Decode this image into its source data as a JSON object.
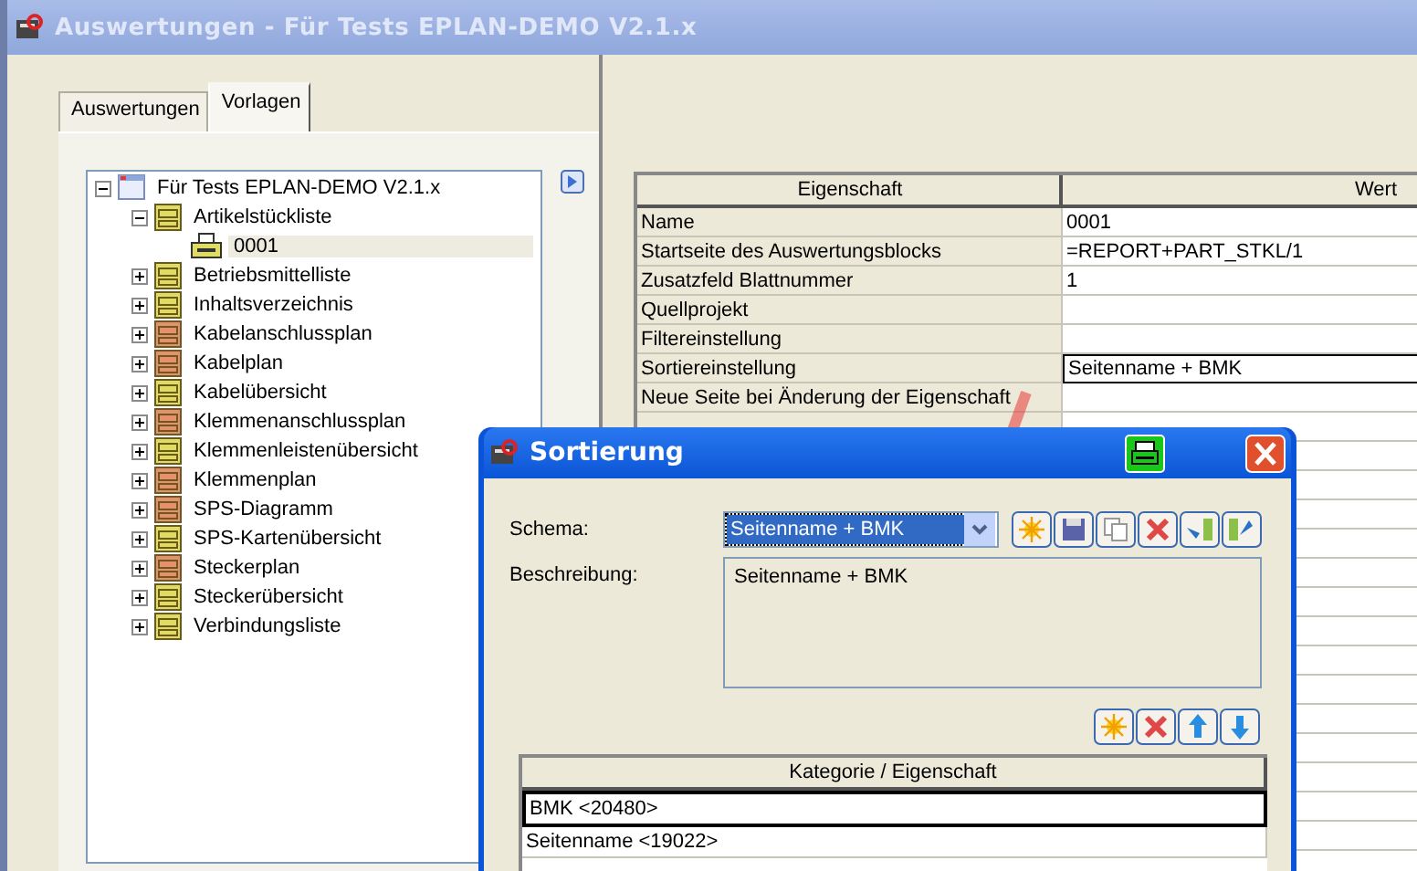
{
  "window": {
    "title": "Auswertungen - Für Tests EPLAN-DEMO V2.1.x"
  },
  "tabs": [
    {
      "label": "Auswertungen",
      "selected": false
    },
    {
      "label": "Vorlagen",
      "selected": true
    }
  ],
  "tree": {
    "label": "Für Tests EPLAN-DEMO V2.1.x",
    "kind": "project",
    "expanded": true,
    "selected": false,
    "children": [
      {
        "label": "Artikelstückliste",
        "kind": "report",
        "color": "#e0dc60",
        "expanded": true,
        "selected": false,
        "children": [
          {
            "label": "0001",
            "kind": "template",
            "selected": true
          }
        ]
      },
      {
        "label": "Betriebsmittelliste",
        "kind": "report",
        "color": "#e0dc60",
        "expanded": false,
        "selected": false
      },
      {
        "label": "Inhaltsverzeichnis",
        "kind": "report",
        "color": "#e0dc60",
        "expanded": false,
        "selected": false
      },
      {
        "label": "Kabelanschlussplan",
        "kind": "report",
        "color": "#e8906c",
        "expanded": false,
        "selected": false
      },
      {
        "label": "Kabelplan",
        "kind": "report",
        "color": "#e8906c",
        "expanded": false,
        "selected": false
      },
      {
        "label": "Kabelübersicht",
        "kind": "report",
        "color": "#e0dc60",
        "expanded": false,
        "selected": false
      },
      {
        "label": "Klemmenanschlussplan",
        "kind": "report",
        "color": "#e8906c",
        "expanded": false,
        "selected": false
      },
      {
        "label": "Klemmenleistenübersicht",
        "kind": "report",
        "color": "#e0dc60",
        "expanded": false,
        "selected": false
      },
      {
        "label": "Klemmenplan",
        "kind": "report",
        "color": "#e8906c",
        "expanded": false,
        "selected": false
      },
      {
        "label": "SPS-Diagramm",
        "kind": "report",
        "color": "#e8906c",
        "expanded": false,
        "selected": false
      },
      {
        "label": "SPS-Kartenübersicht",
        "kind": "report",
        "color": "#e0dc60",
        "expanded": false,
        "selected": false
      },
      {
        "label": "Steckerplan",
        "kind": "report",
        "color": "#e8906c",
        "expanded": false,
        "selected": false
      },
      {
        "label": "Steckerübersicht",
        "kind": "report",
        "color": "#e0dc60",
        "expanded": false,
        "selected": false
      },
      {
        "label": "Verbindungsliste",
        "kind": "report",
        "color": "#e0dc60",
        "expanded": false,
        "selected": false
      }
    ]
  },
  "properties": {
    "columns": [
      "Eigenschaft",
      "Wert"
    ],
    "rows": [
      {
        "name": "Name",
        "value": "0001",
        "selected": false
      },
      {
        "name": "Startseite des Auswertungsblocks",
        "value": "=REPORT+PART_STKL/1",
        "selected": false
      },
      {
        "name": "Zusatzfeld Blattnummer",
        "value": "1",
        "selected": false
      },
      {
        "name": "Quellprojekt",
        "selected": false
      },
      {
        "name": "Filtereinstellung",
        "selected": false
      },
      {
        "name": "Sortiereinstellung",
        "value": "Seitenname + BMK",
        "selected": true
      },
      {
        "name": "Neue Seite bei Änderung der Eigenschaft",
        "selected": false
      }
    ]
  },
  "dialog": {
    "title": "Sortierung",
    "schema_label": "Schema:",
    "schema_value": "Seitenname + BMK",
    "description_label": "Beschreibung:",
    "description": "Seitenname + BMK",
    "list": {
      "column": "Kategorie / Eigenschaft",
      "rows": [
        {
          "label": "BMK <20480>",
          "selected": true
        },
        {
          "label": "Seitenname <19022>",
          "selected": false
        }
      ]
    }
  }
}
